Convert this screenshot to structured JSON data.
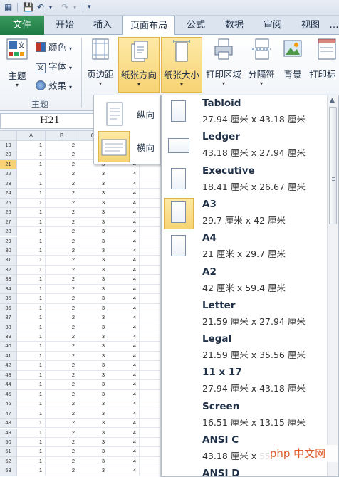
{
  "window": {
    "name_box": "H21"
  },
  "tabs": [
    {
      "label": "文件"
    },
    {
      "label": "开始"
    },
    {
      "label": "插入"
    },
    {
      "label": "页面布局"
    },
    {
      "label": "公式"
    },
    {
      "label": "数据"
    },
    {
      "label": "审阅"
    },
    {
      "label": "视图"
    }
  ],
  "ribbon": {
    "theme_group_label": "主题",
    "theme_button": "主题",
    "colors": "颜色",
    "fonts": "字体",
    "effects": "效果",
    "margins": "页边距",
    "orientation": "纸张方向",
    "size": "纸张大小",
    "print_area": "打印区域",
    "breaks": "分隔符",
    "background": "背景",
    "print_titles": "打印标"
  },
  "orientation_menu": [
    {
      "label": "纵向"
    },
    {
      "label": "横向"
    }
  ],
  "size_menu": [
    {
      "name": "Tabloid",
      "dim": "27.94 厘米 x 43.18 厘米",
      "orient": "portrait"
    },
    {
      "name": "Ledger",
      "dim": "43.18 厘米 x 27.94 厘米",
      "orient": "landscape"
    },
    {
      "name": "Executive",
      "dim": "18.41 厘米 x 26.67 厘米",
      "orient": "portrait"
    },
    {
      "name": "A3",
      "dim": "29.7 厘米 x 42 厘米",
      "orient": "portrait",
      "selected": true
    },
    {
      "name": "A4",
      "dim": "21 厘米 x 29.7 厘米",
      "orient": "portrait"
    },
    {
      "name": "A2",
      "dim": "42 厘米 x 59.4 厘米",
      "orient": "none"
    },
    {
      "name": "Letter",
      "dim": "21.59 厘米 x 27.94 厘米",
      "orient": "none"
    },
    {
      "name": "Legal",
      "dim": "21.59 厘米 x 35.56 厘米",
      "orient": "none"
    },
    {
      "name": "11 x 17",
      "dim": "27.94 厘米 x 43.18 厘米",
      "orient": "none"
    },
    {
      "name": "Screen",
      "dim": "16.51 厘米 x 13.15 厘米",
      "orient": "none"
    },
    {
      "name": "ANSI C",
      "dim": "43.18 厘米 x 55",
      "orient": "none"
    },
    {
      "name": "ANSI D",
      "dim": "",
      "orient": "none"
    }
  ],
  "sheet": {
    "columns": [
      "A",
      "B",
      "C",
      "D"
    ],
    "rows": [
      "19",
      "20",
      "21",
      "22",
      "23",
      "24",
      "25",
      "26",
      "27",
      "28",
      "29",
      "30",
      "31",
      "32",
      "33",
      "34",
      "35",
      "36",
      "37",
      "38",
      "39",
      "40",
      "41",
      "42",
      "43",
      "44",
      "45",
      "46",
      "47",
      "48",
      "49",
      "50",
      "51",
      "52",
      "53"
    ],
    "row_values": [
      "1",
      "2",
      "3",
      "4"
    ],
    "selected_row": "21"
  },
  "watermark": "php 中文网",
  "colors": {
    "file_tab": "#1e7a43",
    "highlight": "#f7d374"
  }
}
